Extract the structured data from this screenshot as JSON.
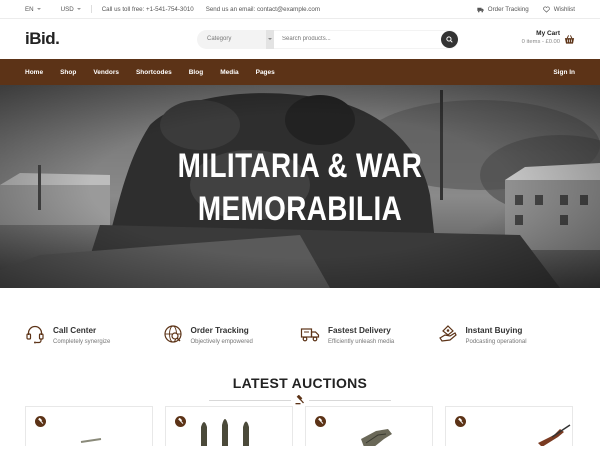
{
  "topbar": {
    "language": "EN",
    "currency": "USD",
    "phone": "Call us toll free: +1-541-754-3010",
    "email": "Send us an email: contact@example.com",
    "order_tracking": "Order Tracking",
    "wishlist": "Wishlist"
  },
  "header": {
    "logo": "iBid.",
    "search_category": "Category",
    "search_placeholder": "Search products...",
    "cart_title": "My Cart",
    "cart_summary": "0 items - £0.00"
  },
  "nav": {
    "items": [
      "Home",
      "Shop",
      "Vendors",
      "Shortcodes",
      "Blog",
      "Media",
      "Pages"
    ],
    "signin": "Sign In"
  },
  "hero": {
    "line1": "MILITARIA & WAR",
    "line2": "MEMORABILIA"
  },
  "features": [
    {
      "title": "Call Center",
      "subtitle": "Completely synergize",
      "icon": "headset-icon"
    },
    {
      "title": "Order Tracking",
      "subtitle": "Objectively empowered",
      "icon": "search-globe-icon"
    },
    {
      "title": "Fastest Delivery",
      "subtitle": "Efficiently unleash media",
      "icon": "truck-icon"
    },
    {
      "title": "Instant Buying",
      "subtitle": "Podcasting operational",
      "icon": "hand-coin-icon"
    }
  ],
  "section": {
    "title": "LATEST AUCTIONS"
  },
  "colors": {
    "brand": "#5c3317",
    "dark": "#222222"
  }
}
